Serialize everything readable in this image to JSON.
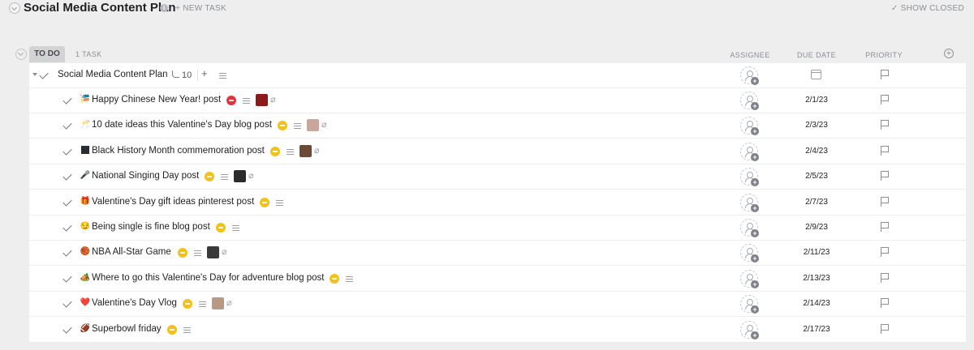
{
  "header": {
    "title": "Social Media Content Plan",
    "info_icon": "info-icon",
    "new_task": "+ NEW TASK",
    "show_closed": "✓ SHOW CLOSED"
  },
  "group": {
    "status": "TO DO",
    "task_count": "1 TASK",
    "columns": {
      "assignee": "ASSIGNEE",
      "due_date": "DUE DATE",
      "priority": "PRIORITY"
    },
    "add_column": "+"
  },
  "parent_task": {
    "name": "Social Media Content Plan",
    "subtask_count": "10",
    "add": "+"
  },
  "subtasks": [
    {
      "emoji": "🎏",
      "name": "Happy Chinese New Year! post",
      "status_color": "#e5323b",
      "thumb_color": "#8b1a1a",
      "has_clip": true,
      "due": "2/1/23"
    },
    {
      "emoji": "🥂",
      "name": "10 date ideas this Valentine's Day blog post",
      "status_color": "#f2c11e",
      "thumb_color": "#c9a59b",
      "has_clip": true,
      "due": "2/3/23"
    },
    {
      "emoji": "🏿",
      "name": "Black History Month commemoration post",
      "status_color": "#f2c11e",
      "thumb_color": "#6b4a36",
      "has_clip": true,
      "due": "2/4/23"
    },
    {
      "emoji": "🎤",
      "name": "National Singing Day post",
      "status_color": "#f2c11e",
      "thumb_color": "#2b2b2b",
      "has_clip": true,
      "due": "2/5/23"
    },
    {
      "emoji": "🎁",
      "name": "Valentine's Day gift ideas pinterest post",
      "status_color": "#f2c11e",
      "thumb_color": "",
      "has_clip": false,
      "due": "2/7/23"
    },
    {
      "emoji": "😏",
      "name": "Being single is fine blog post",
      "status_color": "#f2c11e",
      "thumb_color": "",
      "has_clip": false,
      "due": "2/9/23"
    },
    {
      "emoji": "🏀",
      "name": "NBA All-Star Game",
      "status_color": "#f2c11e",
      "thumb_color": "#3a3a3a",
      "has_clip": true,
      "due": "2/11/23"
    },
    {
      "emoji": "🏕️",
      "name": "Where to go this Valentine's Day for adventure blog post",
      "status_color": "#f2c11e",
      "thumb_color": "",
      "has_clip": false,
      "due": "2/13/23"
    },
    {
      "emoji": "❤️",
      "name": "Valentine's Day Vlog",
      "status_color": "#f2c11e",
      "thumb_color": "#b89a84",
      "has_clip": true,
      "due": "2/14/23"
    },
    {
      "emoji": "🏈",
      "name": "Superbowl friday",
      "status_color": "#f2c11e",
      "thumb_color": "",
      "has_clip": false,
      "due": "2/17/23"
    }
  ]
}
